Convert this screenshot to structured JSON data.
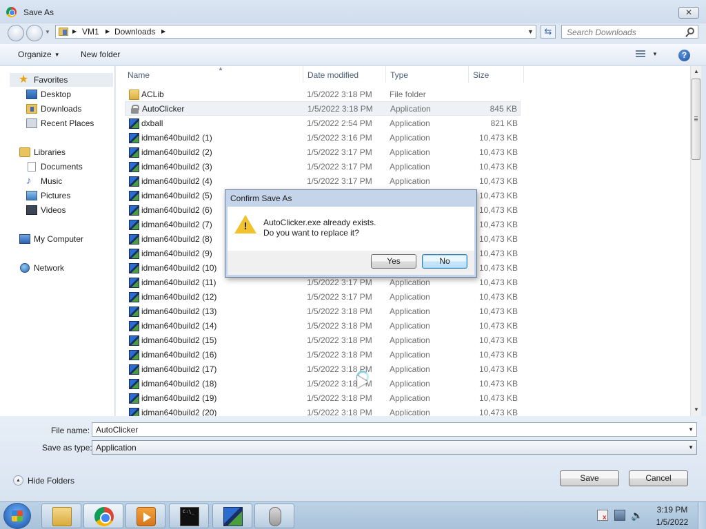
{
  "window": {
    "title": "Save As",
    "close_glyph": "✕"
  },
  "address": {
    "crumbs": [
      "VM1",
      "Downloads"
    ],
    "search_placeholder": "Search Downloads"
  },
  "toolbar": {
    "organize": "Organize",
    "new_folder": "New folder",
    "help": "?"
  },
  "nav": {
    "favorites": "Favorites",
    "desktop": "Desktop",
    "downloads": "Downloads",
    "recent": "Recent Places",
    "libraries": "Libraries",
    "documents": "Documents",
    "music": "Music",
    "pictures": "Pictures",
    "videos": "Videos",
    "computer": "My Computer",
    "network": "Network"
  },
  "columns": {
    "name": "Name",
    "date": "Date modified",
    "type": "Type",
    "size": "Size"
  },
  "files": [
    {
      "name": "ACLib",
      "date": "1/5/2022 3:18 PM",
      "type": "File folder",
      "size": "",
      "icon": "folder-icon"
    },
    {
      "name": "AutoClicker",
      "date": "1/5/2022 3:18 PM",
      "type": "Application",
      "size": "845 KB",
      "icon": "lock-app-icon",
      "selected": true
    },
    {
      "name": "dxball",
      "date": "1/5/2022 2:54 PM",
      "type": "Application",
      "size": "821 KB",
      "icon": "setup-app-icon"
    },
    {
      "name": "idman640build2 (1)",
      "date": "1/5/2022 3:16 PM",
      "type": "Application",
      "size": "10,473 KB",
      "icon": "setup-app-icon"
    },
    {
      "name": "idman640build2 (2)",
      "date": "1/5/2022 3:17 PM",
      "type": "Application",
      "size": "10,473 KB",
      "icon": "setup-app-icon"
    },
    {
      "name": "idman640build2 (3)",
      "date": "1/5/2022 3:17 PM",
      "type": "Application",
      "size": "10,473 KB",
      "icon": "setup-app-icon"
    },
    {
      "name": "idman640build2 (4)",
      "date": "1/5/2022 3:17 PM",
      "type": "Application",
      "size": "10,473 KB",
      "icon": "setup-app-icon"
    },
    {
      "name": "idman640build2 (5)",
      "date": "",
      "type": "",
      "size": "10,473 KB",
      "icon": "setup-app-icon"
    },
    {
      "name": "idman640build2 (6)",
      "date": "",
      "type": "",
      "size": "10,473 KB",
      "icon": "setup-app-icon"
    },
    {
      "name": "idman640build2 (7)",
      "date": "",
      "type": "",
      "size": "10,473 KB",
      "icon": "setup-app-icon"
    },
    {
      "name": "idman640build2 (8)",
      "date": "",
      "type": "",
      "size": "10,473 KB",
      "icon": "setup-app-icon"
    },
    {
      "name": "idman640build2 (9)",
      "date": "",
      "type": "",
      "size": "10,473 KB",
      "icon": "setup-app-icon"
    },
    {
      "name": "idman640build2 (10)",
      "date": "",
      "type": "",
      "size": "10,473 KB",
      "icon": "setup-app-icon"
    },
    {
      "name": "idman640build2 (11)",
      "date": "1/5/2022 3:17 PM",
      "type": "Application",
      "size": "10,473 KB",
      "icon": "setup-app-icon"
    },
    {
      "name": "idman640build2 (12)",
      "date": "1/5/2022 3:17 PM",
      "type": "Application",
      "size": "10,473 KB",
      "icon": "setup-app-icon"
    },
    {
      "name": "idman640build2 (13)",
      "date": "1/5/2022 3:18 PM",
      "type": "Application",
      "size": "10,473 KB",
      "icon": "setup-app-icon"
    },
    {
      "name": "idman640build2 (14)",
      "date": "1/5/2022 3:18 PM",
      "type": "Application",
      "size": "10,473 KB",
      "icon": "setup-app-icon"
    },
    {
      "name": "idman640build2 (15)",
      "date": "1/5/2022 3:18 PM",
      "type": "Application",
      "size": "10,473 KB",
      "icon": "setup-app-icon"
    },
    {
      "name": "idman640build2 (16)",
      "date": "1/5/2022 3:18 PM",
      "type": "Application",
      "size": "10,473 KB",
      "icon": "setup-app-icon"
    },
    {
      "name": "idman640build2 (17)",
      "date": "1/5/2022 3:18 PM",
      "type": "Application",
      "size": "10,473 KB",
      "icon": "setup-app-icon"
    },
    {
      "name": "idman640build2 (18)",
      "date": "1/5/2022 3:18 PM",
      "type": "Application",
      "size": "10,473 KB",
      "icon": "setup-app-icon"
    },
    {
      "name": "idman640build2 (19)",
      "date": "1/5/2022 3:18 PM",
      "type": "Application",
      "size": "10,473 KB",
      "icon": "setup-app-icon"
    },
    {
      "name": "idman640build2 (20)",
      "date": "1/5/2022 3:18 PM",
      "type": "Application",
      "size": "10,473 KB",
      "icon": "setup-app-icon"
    }
  ],
  "form": {
    "file_name_label": "File name:",
    "file_name_value": "AutoClicker",
    "save_type_label": "Save as type:",
    "save_type_value": "Application"
  },
  "footer": {
    "hide_folders": "Hide Folders",
    "save": "Save",
    "cancel": "Cancel"
  },
  "dialog": {
    "title": "Confirm Save As",
    "line1": "AutoClicker.exe already exists.",
    "line2": "Do you want to replace it?",
    "yes": "Yes",
    "no": "No"
  },
  "clock": {
    "time": "3:19 PM",
    "date": "1/5/2022"
  },
  "colors": {
    "accent": "#3c7fb1",
    "selection": "#eef1f5",
    "chrome": "#dfe8f3"
  }
}
